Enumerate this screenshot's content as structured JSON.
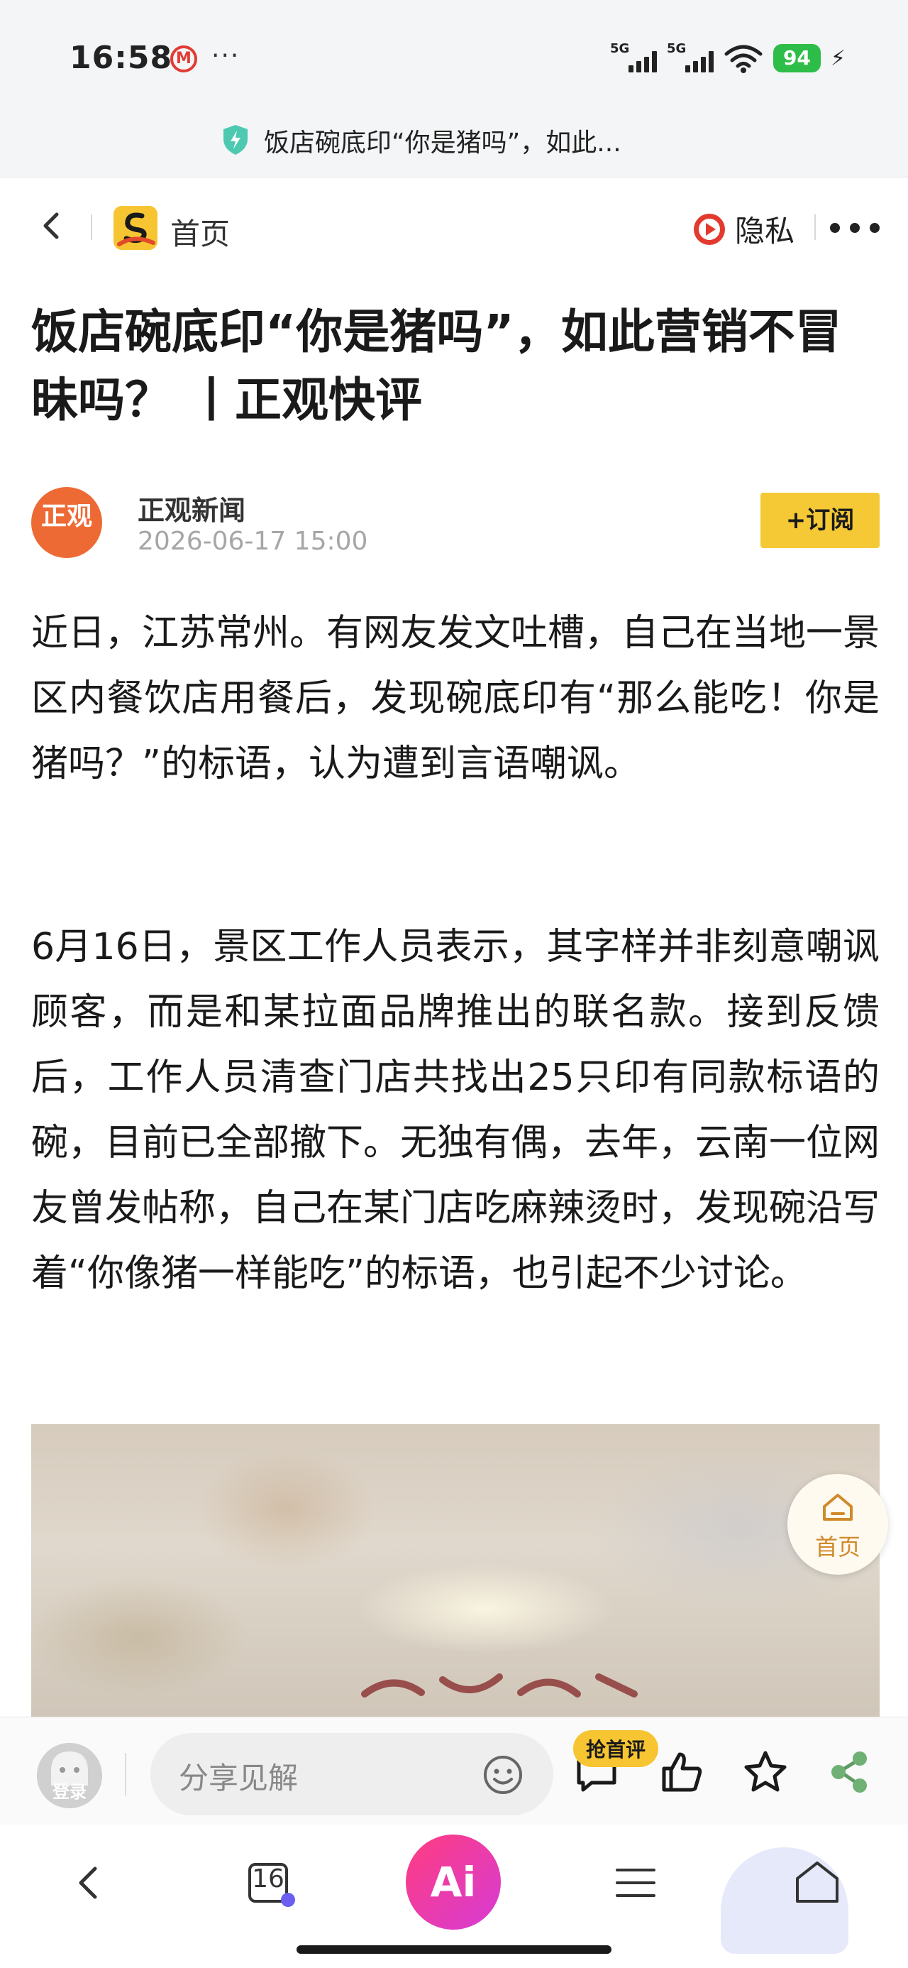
{
  "status_bar": {
    "time": "16:58",
    "metro_glyph": "M",
    "more": "···",
    "network1": "5G",
    "network2": "5G",
    "battery": "94"
  },
  "browser": {
    "page_title": "饭店碗底印“你是猪吗”，如此..."
  },
  "nav": {
    "home_label": "首页",
    "privacy_label": "隐私"
  },
  "article": {
    "title": "饭店碗底印“你是猪吗”，如此营销不冒昧吗？ 丨正观快评",
    "author": {
      "name": "正观新闻",
      "avatar_text": "正观",
      "date": "2026-06-17 15:00",
      "subscribe_label": "+订阅"
    },
    "paragraphs": [
      "近日，江苏常州。有网友发文吐槽，自己在当地一景区内餐饮店用餐后，发现碗底印有“那么能吃！你是猪吗？”的标语，认为遭到言语嘲讽。",
      "6月16日，景区工作人员表示，其字样并非刻意嘲讽顾客，而是和某拉面品牌推出的联名款。接到反馈后，工作人员清查门店共找出25只印有同款标语的碗，目前已全部撤下。无独有偶，去年，云南一位网友曾发帖称，自己在某门店吃麻辣烫时，发现碗沿写着“你像猪一样能吃”的标语，也引起不少讨论。"
    ]
  },
  "floating": {
    "home_label": "首页"
  },
  "comment_bar": {
    "login_label": "登录",
    "input_placeholder": "分享见解",
    "first_comment_badge": "抢首评"
  },
  "bottom_bar": {
    "tabs_count": "16",
    "ai_label": "Ai"
  },
  "colors": {
    "accent_yellow": "#f5c935",
    "author_avatar_orange": "#ee6a35",
    "battery_green": "#2ebd49",
    "ai_gradient_start": "#ff3d7f",
    "ai_gradient_end": "#d63bd6"
  },
  "icons": {
    "status": [
      "metro-icon",
      "signal-icon",
      "wifi-icon",
      "battery-icon",
      "charging-icon"
    ],
    "nav": [
      "back-icon",
      "app-logo-icon",
      "privacy-play-icon",
      "more-icon"
    ],
    "comment_bar": [
      "emoji-icon",
      "comment-icon",
      "like-icon",
      "star-icon",
      "share-icon"
    ],
    "bottom_bar": [
      "back-icon",
      "tabs-icon",
      "ai-icon",
      "menu-icon",
      "home-icon"
    ]
  }
}
